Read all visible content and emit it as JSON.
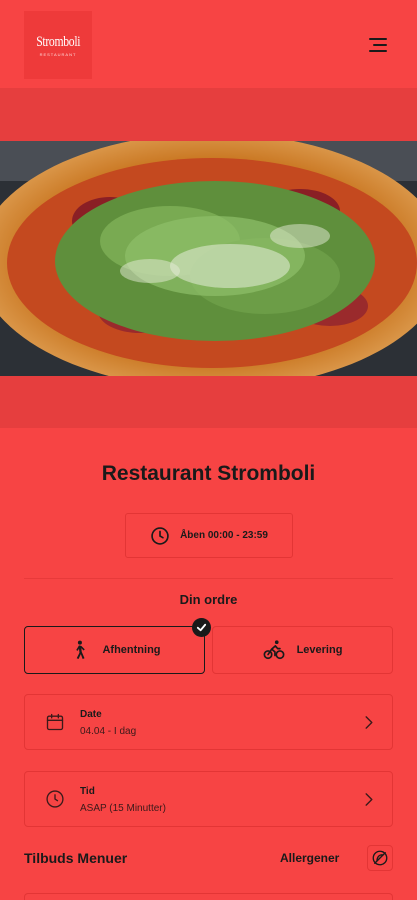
{
  "header": {
    "logo_text": "Stromboli",
    "logo_sub": "RESTAURANT",
    "menu_icon": "hamburger-menu-icon"
  },
  "hero": {
    "image": "pizza-with-arugula-and-salami"
  },
  "restaurant": {
    "name": "Restaurant Stromboli",
    "hours": "Åben 00:00 - 23:59",
    "hours_icon": "clock-icon"
  },
  "order": {
    "label": "Din ordre",
    "modes": [
      {
        "label": "Afhentning",
        "icon": "walking-person-icon",
        "selected": true
      },
      {
        "label": "Levering",
        "icon": "bicycle-rider-icon",
        "selected": false
      }
    ],
    "date": {
      "label": "Date",
      "value": "04.04 - I dag",
      "icon": "calendar-icon"
    },
    "time": {
      "label": "Tid",
      "value": "ASAP (15 Minutter)",
      "icon": "clock-icon"
    }
  },
  "menus": {
    "title": "Tilbuds Menuer",
    "allergens_label": "Allergener",
    "allergens_icon": "no-allergen-icon"
  },
  "colors": {
    "background": "#f74444",
    "band": "#e63e3e",
    "text": "#1a1a1a"
  }
}
